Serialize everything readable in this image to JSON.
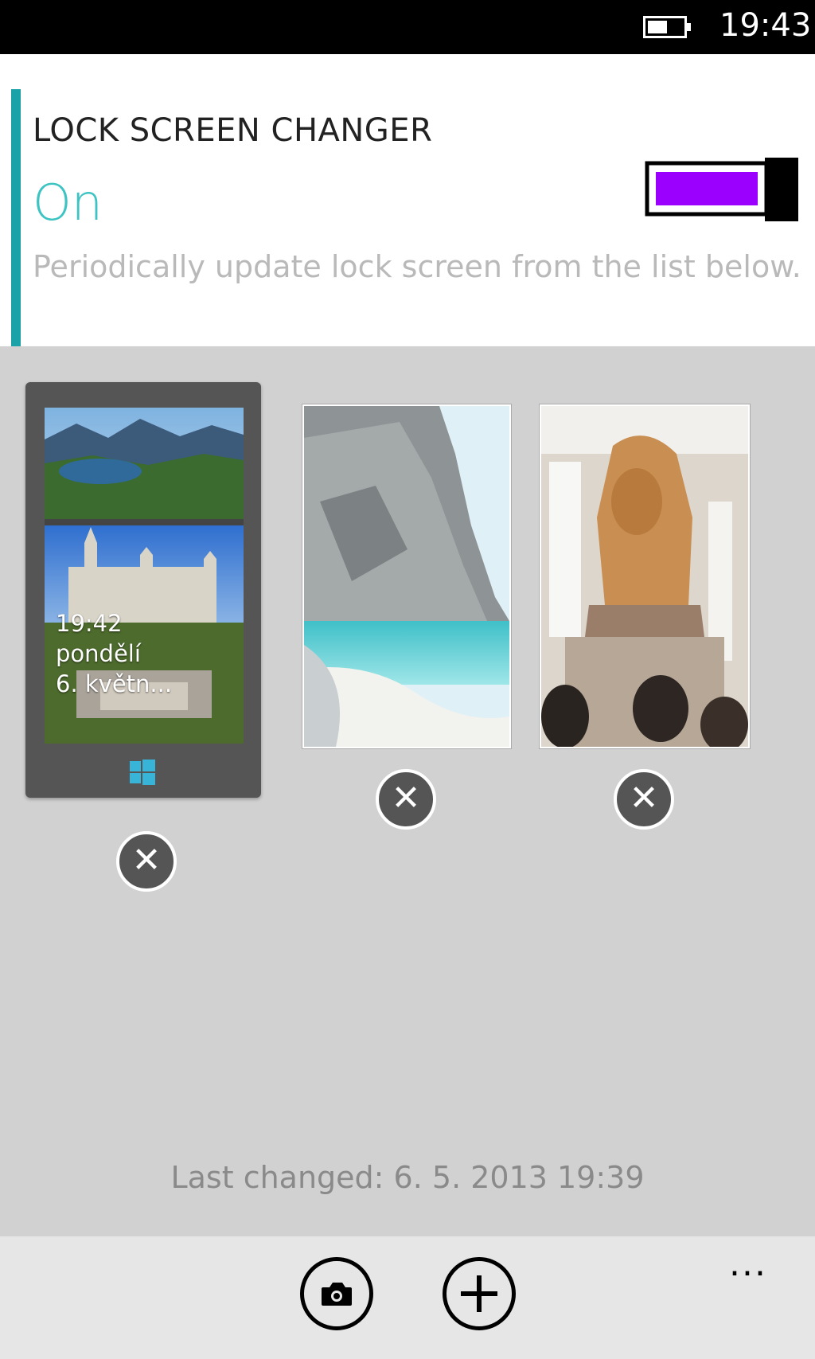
{
  "status_bar": {
    "time": "19:43",
    "battery_icon": "battery-icon"
  },
  "header": {
    "title": "LOCK SCREEN CHANGER",
    "state": "On",
    "description": "Periodically update lock screen from the list below.",
    "toggle_on": true,
    "toggle_color": "#9b00ff",
    "accent_color": "#1ba1a8"
  },
  "gallery": {
    "images": [
      {
        "subject": "castle and lake",
        "selected": true,
        "lock_preview": {
          "time": "19:42",
          "day": "pondělí",
          "date": "6. květn..."
        }
      },
      {
        "subject": "cliff and sea",
        "selected": false
      },
      {
        "subject": "pharaoh statue in museum",
        "selected": false
      }
    ],
    "remove_icon": "close-icon",
    "remove_glyph": "✕"
  },
  "footer": {
    "last_changed": "Last changed: 6. 5. 2013 19:39"
  },
  "app_bar": {
    "camera_icon": "camera-icon",
    "add_icon": "plus-icon",
    "more": "..."
  }
}
